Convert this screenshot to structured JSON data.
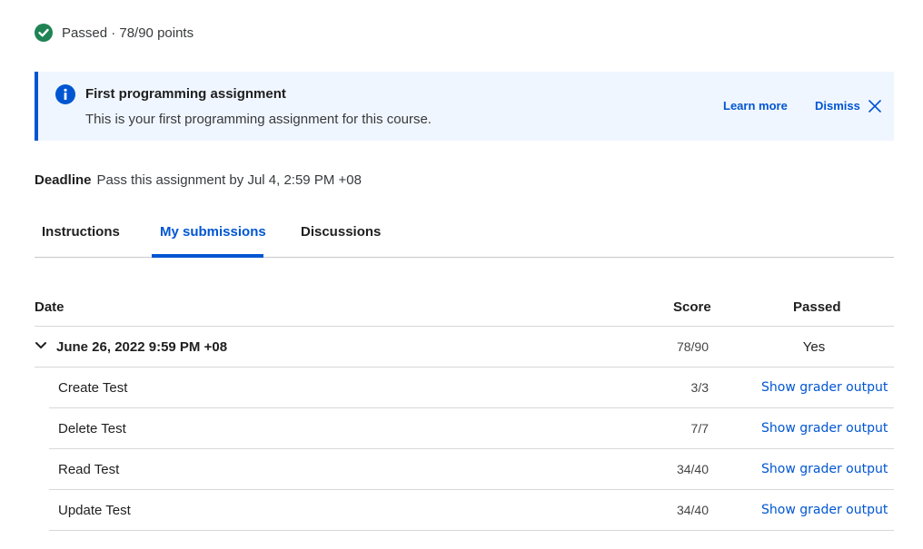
{
  "status": {
    "icon": "check-circle-icon",
    "text": "Passed · 78/90 points",
    "color": "#1f8354"
  },
  "banner": {
    "icon": "info-icon",
    "title": "First programming assignment",
    "text": "This is your first programming assignment for this course.",
    "learn_more": "Learn more",
    "dismiss": "Dismiss",
    "accent": "#0056d2",
    "background": "#f0f6ff"
  },
  "deadline": {
    "label": "Deadline",
    "text": "Pass this assignment by Jul 4, 2:59 PM +08"
  },
  "tabs": [
    {
      "label": "Instructions",
      "active": false
    },
    {
      "label": "My submissions",
      "active": true
    },
    {
      "label": "Discussions",
      "active": false
    }
  ],
  "table": {
    "headers": {
      "date": "Date",
      "score": "Score",
      "passed": "Passed"
    },
    "submission": {
      "date": "June 26, 2022 9:59 PM +08",
      "score": "78/90",
      "passed": "Yes"
    },
    "tests": [
      {
        "name": "Create Test",
        "score": "3/3",
        "link": "Show grader output"
      },
      {
        "name": "Delete Test",
        "score": "7/7",
        "link": "Show grader output"
      },
      {
        "name": "Read Test",
        "score": "34/40",
        "link": "Show grader output"
      },
      {
        "name": "Update Test",
        "score": "34/40",
        "link": "Show grader output"
      }
    ]
  }
}
